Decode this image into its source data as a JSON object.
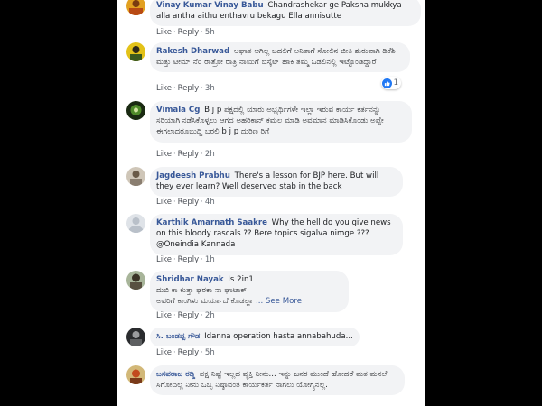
{
  "actions": {
    "like": "Like",
    "reply": "Reply",
    "sep": "·",
    "see_more": "... See More"
  },
  "comments": [
    {
      "author": "Vinay Kumar Vinay Babu",
      "text": "Chandrashekar ge Paksha mukkya alla antha aithu enthavru bekagu Ella annisutte",
      "time": "5h"
    },
    {
      "author": "Rakesh Dharwad",
      "text": "ಆಘಾತ ಆಗಿಲ್ಲ ಬದಲಿಗೆ ಅನಿತಾಗೆ ಸೋಲಿನ ಬೀತಿ ಶುರುವಾಗಿ ಡಿಕೆಶಿ ಮತ್ತು ಟೀಮ್ ನೆರಿ ರಾತ್ರೋ ರಾತ್ರಿ ನಾಯಿಗೆ ಬಿಸ್ಕೆಟ್ ಹಾಕಿ ತಮ್ಮ ಒಡಲಿನಲ್ಲಿ ಇಟ್ಟೊಂಡಿದ್ದಾರೆ",
      "time": "3h",
      "reaction_count": "1"
    },
    {
      "author": "Vimala Cg",
      "text": "B j p ಪಕ್ಷದಲ್ಲಿ ಯಾರು ಅಭ್ಯರ್ಥಿಗಳೇ ಇಲ್ಲಾ ಇರುವ ಕಾರ್ಯ ಕರ್ತನನ್ನು ಸರಿಯಾಗಿ ನಡೆಸಿಕೊಳ್ಳಲು ಆಗದ ಅಹರಿಕಾನ್ ಕಮಲ ಮಾಡಿ ಅವಮಾನ ಮಾಡಿಸಿಕೊಂಡು ಅಪ್ಪೇ ಈಗಲಾದರೂಬುದ್ಧಿ ಬರಲಿ b j p ದುರಿಣ ರಿಗೆ",
      "time": "2h"
    },
    {
      "author": "Jagdeesh Prabhu",
      "text": "There's a lesson for BJP here. But will they ever learn? Well deserved stab in the back",
      "time": "4h"
    },
    {
      "author": "Karthik Amarnath Saakre",
      "text": "Why the hell do you give news on this bloody rascals ?? Bere topics sigalva nimge ??? @Oneindia Kannada",
      "time": "1h"
    },
    {
      "author": "Shridhar Nayak",
      "line1": "Is 2in1",
      "line2": "ದುಬಿ ಕಾ ಕುತ್ತಾ ಘರಕಾ ನಾ ಘಾಟಾಕ್",
      "line3": "ಅವರಿಗೆ ಕಾಂಗಿಳು ಮರ್ಯಾದೆ ಕೊಡಲ್ಲಾ",
      "time": "2h"
    },
    {
      "author": "ಸಿ. ಬಂಡಪ್ಪ ಗೌಡ",
      "text": "Idanna operation hasta annabahuda...",
      "time": "5h"
    },
    {
      "author": "ಬಸವರಾಜ ರಡ್ಡಿ",
      "text": "ಪಕ್ಷ ನಿಷ್ಟೆ ಇಲ್ಲದ ವ್ಯಕ್ತಿ ನೀನು... ಇನ್ನು ಜನರ ಮುಂದೆ ಹೋದರೆ ಮತ ಮನಲೆ ಸಿಗೋದಿಲ್ಲ ನೀನು ಒಬ್ಬ ನಿಷ್ಠಾವಂತ ಕಾರ್ಯಕರ್ತ ನಾಗಲು ಯೋಗ್ಯನಲ್ಲ."
    }
  ],
  "colors": {
    "author": "#385898",
    "bubble": "#f2f3f5",
    "meta": "#606770",
    "like": "#2078f4"
  }
}
